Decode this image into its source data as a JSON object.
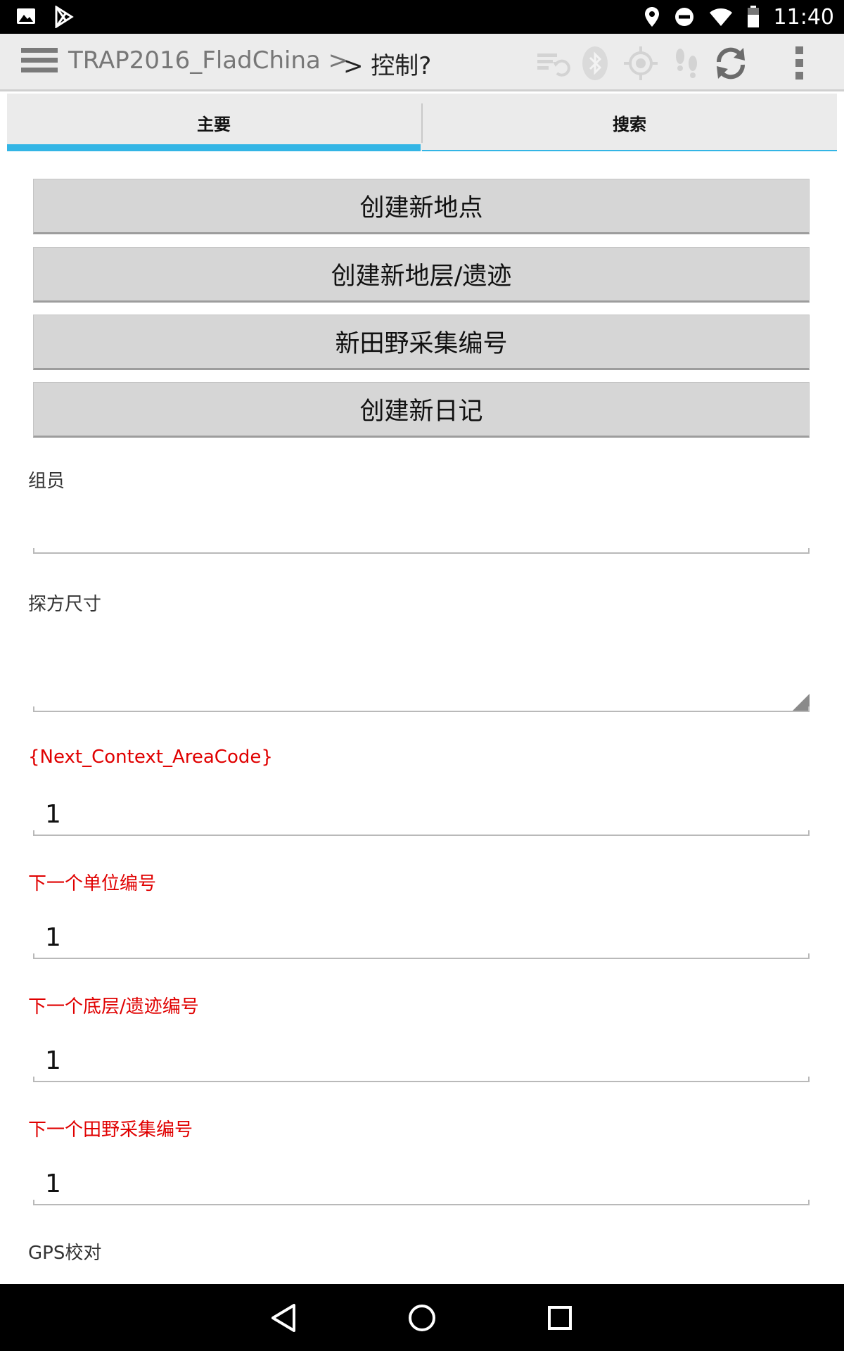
{
  "status_bar": {
    "time": "11:40",
    "left_icons": [
      "image-icon",
      "play-store-icon"
    ],
    "right_icons": [
      "location-icon",
      "do-not-disturb-icon",
      "wifi-icon",
      "battery-icon"
    ]
  },
  "action_bar": {
    "breadcrumb_project": "TRAP2016_FladChina >",
    "breadcrumb_current": "> 控制?",
    "icons": [
      "sync-status-icon",
      "bluetooth-icon",
      "gps-icon",
      "footsteps-icon",
      "refresh-icon",
      "overflow-menu-icon"
    ]
  },
  "tabs": [
    {
      "label": "主要",
      "active": true
    },
    {
      "label": "搜索",
      "active": false
    }
  ],
  "buttons": [
    {
      "label": "创建新地点"
    },
    {
      "label": "创建新地层/遗迹"
    },
    {
      "label": "新田野采集编号"
    },
    {
      "label": "创建新日记"
    }
  ],
  "fields": {
    "team_members": {
      "label": "组员",
      "value": ""
    },
    "trench_size": {
      "label": "探方尺寸",
      "value": ""
    },
    "next_context_area_code": {
      "label": "{Next_Context_AreaCode}",
      "value": "1"
    },
    "next_unit_number": {
      "label": "下一个单位编号",
      "value": "1"
    },
    "next_stratum_feature_number": {
      "label": "下一个底层/遗迹编号",
      "value": "1"
    },
    "next_field_collection_number": {
      "label": "下一个田野采集编号",
      "value": "1"
    },
    "gps_calibration": {
      "label": "GPS校对"
    }
  },
  "colors": {
    "accent": "#33b5e5",
    "required_label": "#e00000",
    "button_bg": "#d6d6d6"
  },
  "nav_bar": {
    "icons": [
      "back-icon",
      "home-icon",
      "recents-icon"
    ]
  }
}
